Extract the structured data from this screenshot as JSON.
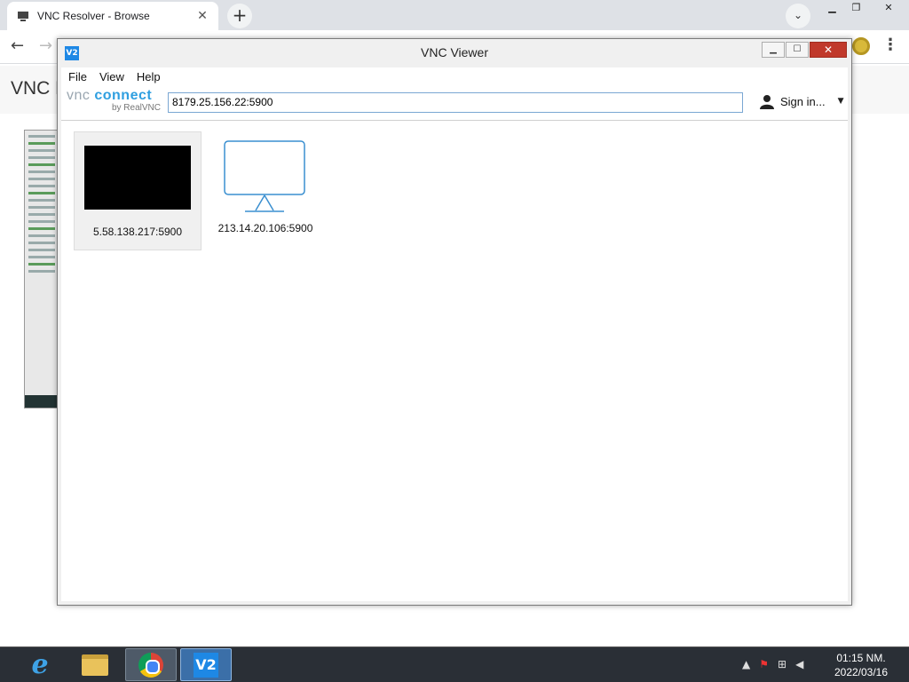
{
  "browser": {
    "tab_title": "VNC Resolver - Browse",
    "page_heading": "VNC R"
  },
  "vnc": {
    "window_title": "VNC Viewer",
    "menu": [
      "File",
      "View",
      "Help"
    ],
    "logo_line1_a": "vnc",
    "logo_line1_b": "connect",
    "logo_line2": "by RealVNC",
    "address_value": "8179.25.156.22:5900",
    "sign_in_label": "Sign in...",
    "entries": [
      {
        "label": "5.58.138.217:5900"
      },
      {
        "label": "213.14.20.106:5900"
      }
    ]
  },
  "taskbar": {
    "time": "01:15 NM.",
    "date": "2022/03/16"
  },
  "colors": {
    "vnc_accent": "#1e88e5",
    "taskbar_bg": "#2a2f36"
  }
}
